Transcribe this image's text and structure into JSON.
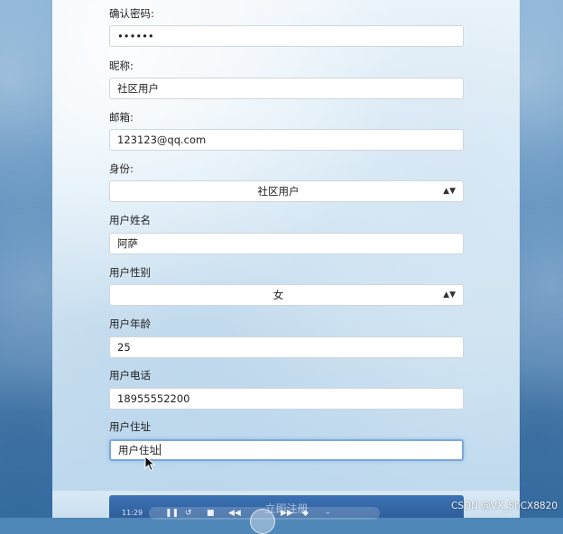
{
  "form": {
    "confirm_password": {
      "label": "确认密码:",
      "value": "••••••"
    },
    "nickname": {
      "label": "昵称:",
      "value": "社区用户"
    },
    "email": {
      "label": "邮箱:",
      "value": "123123@qq.com"
    },
    "identity": {
      "label": "身份:",
      "value": "社区用户"
    },
    "user_name": {
      "label": "用户姓名",
      "value": "阿萨"
    },
    "user_gender": {
      "label": "用户性别",
      "value": "女"
    },
    "user_age": {
      "label": "用户年龄",
      "value": "25"
    },
    "user_phone": {
      "label": "用户电话",
      "value": "18955552200"
    },
    "user_address": {
      "label": "用户住址",
      "value": "用户住址"
    },
    "submit": {
      "label": "立即注册"
    }
  },
  "player": {
    "time": "11:29"
  },
  "watermark": "CSDN @VX_ShCX8820",
  "colors": {
    "button_blue": "#3c72b4",
    "focus_border": "#7fa7d6",
    "background_blue": "#4f87b8"
  },
  "icons": {
    "select_arrow": "updown-arrow-icon",
    "mouse": "mouse-pointer-icon"
  }
}
